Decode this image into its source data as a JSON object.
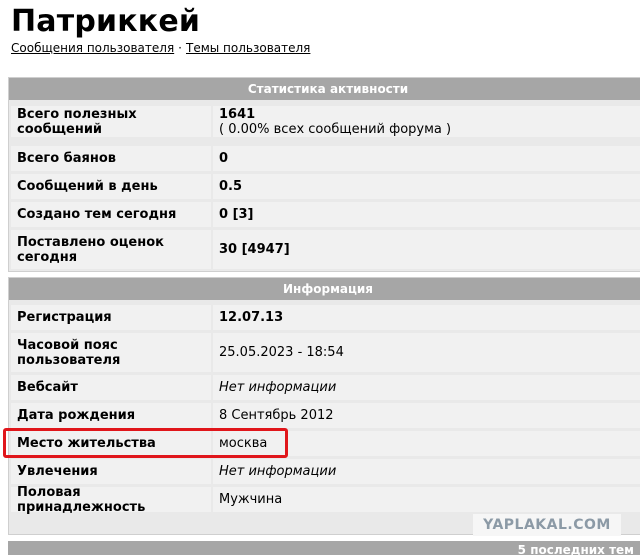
{
  "page": {
    "title": "Патриккей",
    "links": [
      "Сообщения пользователя",
      "Темы пользователя"
    ],
    "separator": "·"
  },
  "stats": {
    "header": "Статистика активности",
    "rows": [
      {
        "label": "Всего полезных сообщений",
        "value": "1641",
        "sub": "( 0.00% всех сообщений форума )"
      },
      {
        "label": "Всего баянов",
        "value": "0"
      },
      {
        "label": "Сообщений в день",
        "value": "0.5"
      },
      {
        "label": "Создано тем сегодня",
        "value": "0 [3]"
      },
      {
        "label": "Поставлено оценок сегодня",
        "value": "30 [4947]"
      }
    ]
  },
  "info": {
    "header": "Информация",
    "rows": [
      {
        "label": "Регистрация",
        "value": "12.07.13"
      },
      {
        "label": "Часовой пояс пользователя",
        "value": "25.05.2023 - 18:54"
      },
      {
        "label": "Вебсайт",
        "value": "Нет информации"
      },
      {
        "label": "Дата рождения",
        "value": "8 Сентябрь 2012"
      },
      {
        "label": "Место жительства",
        "value": "москва"
      },
      {
        "label": "Увлечения",
        "value": "Нет информации"
      },
      {
        "label": "Половая принадлежность",
        "value": "Мужчина"
      }
    ]
  },
  "watermark": "YAPLAKAL.COM",
  "bottom_bar": "5 последних тем",
  "colors": {
    "header_bg": "#a6a6a6",
    "highlight": "#e0161b",
    "cell_bg": "#f1f1f1"
  }
}
